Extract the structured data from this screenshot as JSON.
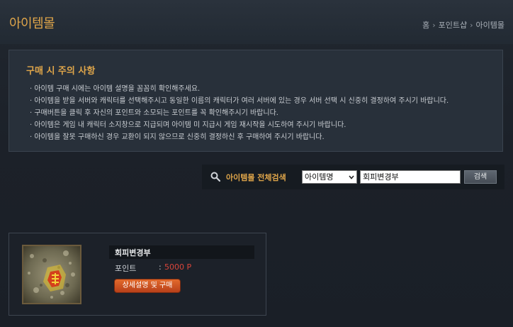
{
  "header": {
    "title": "아이템몰",
    "breadcrumb": [
      "홈",
      "포인트샵",
      "아이템몰"
    ]
  },
  "notice": {
    "title": "구매 시 주의 사항",
    "items": [
      "아이템 구매 시에는 아이템 설명을 꼼꼼히 확인해주세요.",
      "아이템을 받을 서버와 캐릭터를 선택해주시고 동일한 이름의 캐릭터가 여러 서버에 있는 경우 서버 선택 시 신중히 결정하여 주시기 바랍니다.",
      "구매버튼을 클릭 후 자신의 포인트와 소모되는 포인트를 꼭 확인해주시기 바랍니다.",
      "아이템은 게임 내 캐릭터 소지창으로 지급되며 아이템 미 지급시 게임 재시작을 시도하여 주시기 바랍니다.",
      "아이템을 잘못 구매하신 경우 교환이 되지 않으므로 신중히 결정하신 후 구매하여 주시기 바랍니다."
    ]
  },
  "search": {
    "label": "아이템몰 전체검색",
    "select_value": "아이템명",
    "input_value": "회피변경부",
    "button_label": "검색",
    "icon": "search-icon"
  },
  "product": {
    "name": "회피변경부",
    "price_label": "포인트",
    "price_colon": ":",
    "price_value": "5000 P",
    "button_label": "상세설명 및 구매"
  },
  "colors": {
    "accent": "#e0a64a",
    "price": "#d9453a",
    "button": "#d15a26"
  }
}
